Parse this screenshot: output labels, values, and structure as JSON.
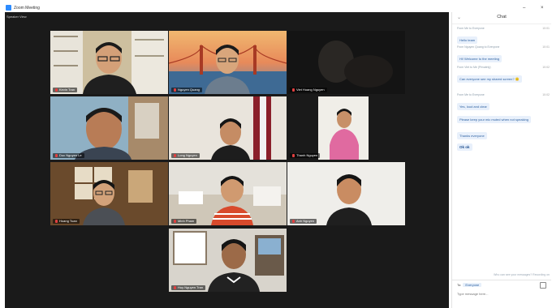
{
  "window": {
    "title": "Zoom Meeting",
    "minimize": "–",
    "close": "×"
  },
  "meeting": {
    "speaker_label": "Speaker View",
    "participants": [
      {
        "name": "Kevin Tran"
      },
      {
        "name": "Nguyen Quang"
      },
      {
        "name": "Viet Hoang Nguyen"
      },
      {
        "name": "Duc Nguyen Le"
      },
      {
        "name": "Long Nguyen"
      },
      {
        "name": "Thanh Nguyen"
      },
      {
        "name": "Hoang Tuan"
      },
      {
        "name": "Minh Pham"
      },
      {
        "name": "Anh Nguyen"
      },
      {
        "name": "Huy Nguyen Tran"
      }
    ]
  },
  "chat": {
    "title": "Chat",
    "messages": [
      {
        "from": "From Me to Everyone",
        "time": "10:01",
        "text": "Hello team"
      },
      {
        "from": "From Nguyen Quang to Everyone",
        "time": "10:01",
        "text": "Hi! Welcome to the meeting"
      },
      {
        "from": "From Viet to Me (Privately)",
        "time": "10:02",
        "text": "Can everyone see my shared screen? 🙂"
      },
      {
        "from": "From Me to Everyone",
        "time": "10:02",
        "text": "Yes, loud and clear"
      },
      {
        "from": "",
        "time": "",
        "text": "Please keep your mic muted when not speaking"
      },
      {
        "from": "",
        "time": "",
        "text": "Thanks everyone"
      },
      {
        "from": "",
        "time": "",
        "text": "Ok ok"
      }
    ],
    "note": "Who can see your messages? Recording on",
    "to_label": "To:",
    "to_value": "Everyone",
    "input_placeholder": "Type message here..."
  }
}
